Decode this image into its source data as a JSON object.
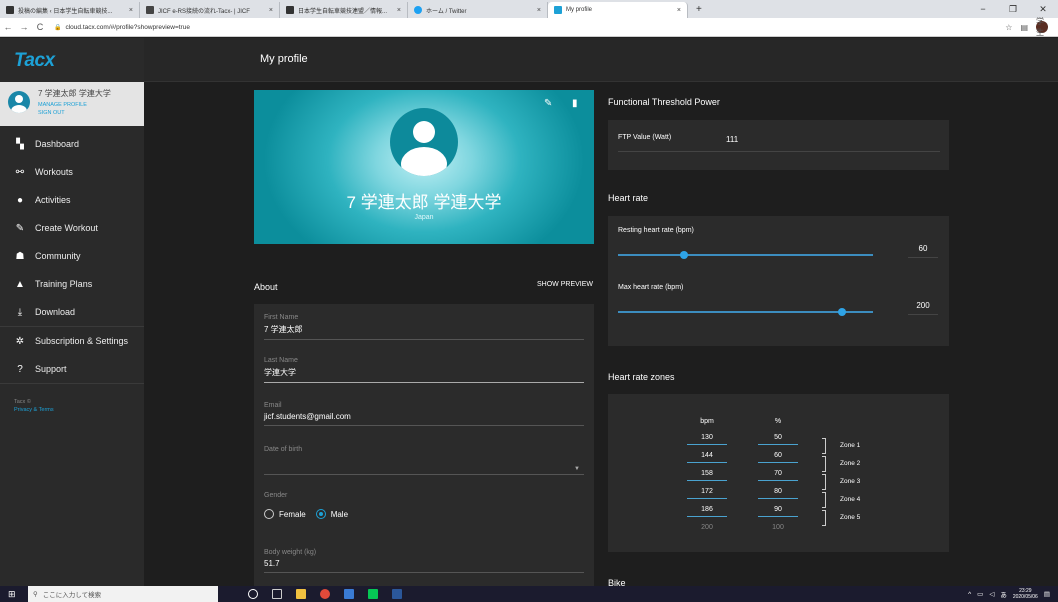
{
  "browser": {
    "tabs": [
      {
        "title": "投稿の編集 ‹ 日本学生自転車競技...",
        "active": false,
        "color": "#333333"
      },
      {
        "title": "JICF e-RS接続の流れ-Tacx- | JICF",
        "active": false,
        "color": "#444444"
      },
      {
        "title": "日本学生自転車競技連盟／情報...",
        "active": false,
        "color": "#333333"
      },
      {
        "title": "ホーム / Twitter",
        "active": false,
        "color": "#1da1f2"
      },
      {
        "title": "My profile",
        "active": true,
        "color": "#1da1d6"
      }
    ],
    "close_glyph": "×",
    "newtab_glyph": "+",
    "window_controls": [
      "−",
      "❐",
      "✕"
    ],
    "url": "cloud.tacx.com/#/profile?showpreview=true",
    "nav": [
      "←",
      "→",
      "C"
    ],
    "right_icons": [
      "☆",
      "▤"
    ],
    "account_badge": "学生"
  },
  "app": {
    "logo": "Tacx",
    "page_title": "My profile",
    "user": {
      "name": "7 学連太郎 学連大学",
      "manage": "MANAGE PROFILE",
      "signout": "SIGN OUT"
    },
    "nav_items": [
      {
        "label": "Dashboard",
        "icon": "dashboard-icon",
        "glyph": "▚"
      },
      {
        "label": "Workouts",
        "icon": "bike-icon",
        "glyph": "⚯"
      },
      {
        "label": "Activities",
        "icon": "clock-icon",
        "glyph": "●"
      },
      {
        "label": "Create Workout",
        "icon": "pencil-icon",
        "glyph": "✎"
      },
      {
        "label": "Community",
        "icon": "group-icon",
        "glyph": "☗"
      },
      {
        "label": "Training Plans",
        "icon": "plans-icon",
        "glyph": "▲"
      },
      {
        "label": "Download",
        "icon": "download-icon",
        "glyph": "⤓"
      },
      {
        "label": "Subscription & Settings",
        "icon": "gear-icon",
        "glyph": "✲"
      },
      {
        "label": "Support",
        "icon": "help-icon",
        "glyph": "?"
      }
    ],
    "footer": {
      "copyright": "Tacx ©",
      "privacy": "Privacy & Terms"
    }
  },
  "profile": {
    "cover_name": "7 学連太郎 学連大学",
    "country": "Japan",
    "about_title": "About",
    "show_preview": "SHOW PREVIEW",
    "first_name_label": "First Name",
    "first_name": "7 学連太郎",
    "last_name_label": "Last Name",
    "last_name": "学連大学",
    "email_label": "Email",
    "email": "jicf.students@gmail.com",
    "dob_label": "Date of birth",
    "dob": "",
    "gender_label": "Gender",
    "gender_female": "Female",
    "gender_male": "Male",
    "gender_selected": "Male",
    "weight_label": "Body weight (kg)",
    "weight": "51.7"
  },
  "ftp": {
    "title": "Functional Threshold Power",
    "label": "FTP Value (Watt)",
    "value": "111"
  },
  "heart_rate": {
    "title": "Heart rate",
    "resting_label": "Resting heart rate (bpm)",
    "resting_value": "60",
    "resting_fraction": 0.26,
    "max_label": "Max heart rate (bpm)",
    "max_value": "200",
    "max_fraction": 0.88
  },
  "zones": {
    "title": "Heart rate zones",
    "bpm_header": "bpm",
    "pct_header": "%",
    "bpm": [
      "130",
      "144",
      "158",
      "172",
      "186",
      "200"
    ],
    "pct": [
      "50",
      "60",
      "70",
      "80",
      "90",
      "100"
    ],
    "labels": [
      "Zone 1",
      "Zone 2",
      "Zone 3",
      "Zone 4",
      "Zone 5"
    ]
  },
  "bike_title": "Bike",
  "taskbar": {
    "search_placeholder": "ここに入力して検索",
    "time": "23:29",
    "date": "2020/05/06",
    "ime": "あ"
  }
}
